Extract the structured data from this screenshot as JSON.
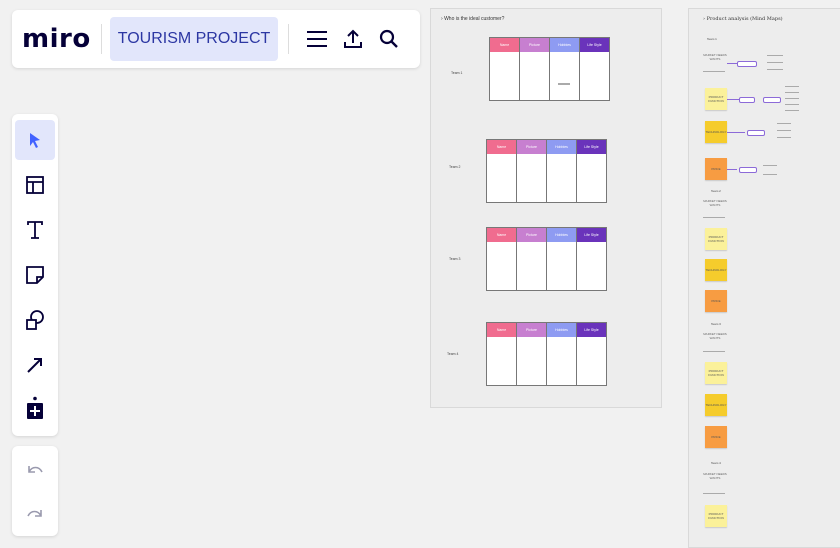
{
  "app": {
    "logo": "miro",
    "board_name": "TOURISM PROJECT"
  },
  "icons": {
    "menu": "menu-icon",
    "share": "upload-icon",
    "search": "search-icon",
    "select": "cursor-icon",
    "templates": "template-icon",
    "text": "text-icon",
    "sticky": "sticky-note-icon",
    "shapes": "shapes-icon",
    "connector": "arrow-icon",
    "more": "add-apps-icon",
    "undo": "undo-icon",
    "redo": "redo-icon",
    "collapse": "chevron-right-icon"
  },
  "colors": {
    "accent": "#4262ff",
    "name": "#f06c8f",
    "picture": "#c77fd0",
    "hobbies": "#8e9bf2",
    "lifestyle": "#6a33bb",
    "yellow": "#fbf19a",
    "gold": "#f5cc2c",
    "orange": "#f79c42"
  },
  "frame1": {
    "title": "Who is the ideal customer?",
    "headers": [
      "Name",
      "Picture",
      "Hobbies",
      "Life Style"
    ],
    "teams": [
      "Team 1",
      "Team 2",
      "Team 3",
      "Team 4"
    ]
  },
  "frame2": {
    "title": "Product analysis (Mind Maps)",
    "teams": [
      "Team 1",
      "Team 2",
      "Team 3",
      "Team 4"
    ],
    "market": "MARKET NEEDS WANTS",
    "product": "PRODUCT FUNCTION",
    "technology": "TECHNOLOGY",
    "price": "PRICE"
  }
}
